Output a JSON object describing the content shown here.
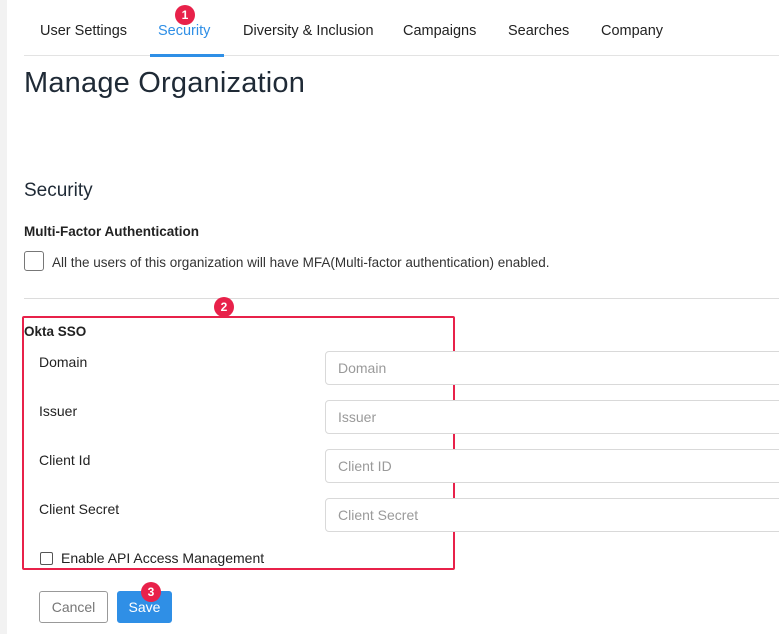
{
  "tabs": [
    {
      "label": "User Settings",
      "active": false
    },
    {
      "label": "Security",
      "active": true
    },
    {
      "label": "Diversity & Inclusion",
      "active": false
    },
    {
      "label": "Campaigns",
      "active": false
    },
    {
      "label": "Searches",
      "active": false
    },
    {
      "label": "Company",
      "active": false
    }
  ],
  "badges": {
    "one": "1",
    "two": "2",
    "three": "3"
  },
  "page_title": "Manage Organization",
  "security": {
    "title": "Security",
    "mfa": {
      "title": "Multi-Factor Authentication",
      "checkbox_label": "All the users of this organization will have MFA(Multi-factor authentication) enabled.",
      "checked": false
    }
  },
  "okta": {
    "title": "Okta SSO",
    "fields": [
      {
        "label": "Domain",
        "placeholder": "Domain",
        "value": ""
      },
      {
        "label": "Issuer",
        "placeholder": "Issuer",
        "value": ""
      },
      {
        "label": "Client Id",
        "placeholder": "Client ID",
        "value": ""
      },
      {
        "label": "Client Secret",
        "placeholder": "Client Secret",
        "value": ""
      }
    ],
    "api_access_label": "Enable API Access Management",
    "api_access_checked": false
  },
  "actions": {
    "cancel_label": "Cancel",
    "save_label": "Save"
  },
  "colors": {
    "accent": "#2f8fe6",
    "annotation": "#e8214a"
  }
}
